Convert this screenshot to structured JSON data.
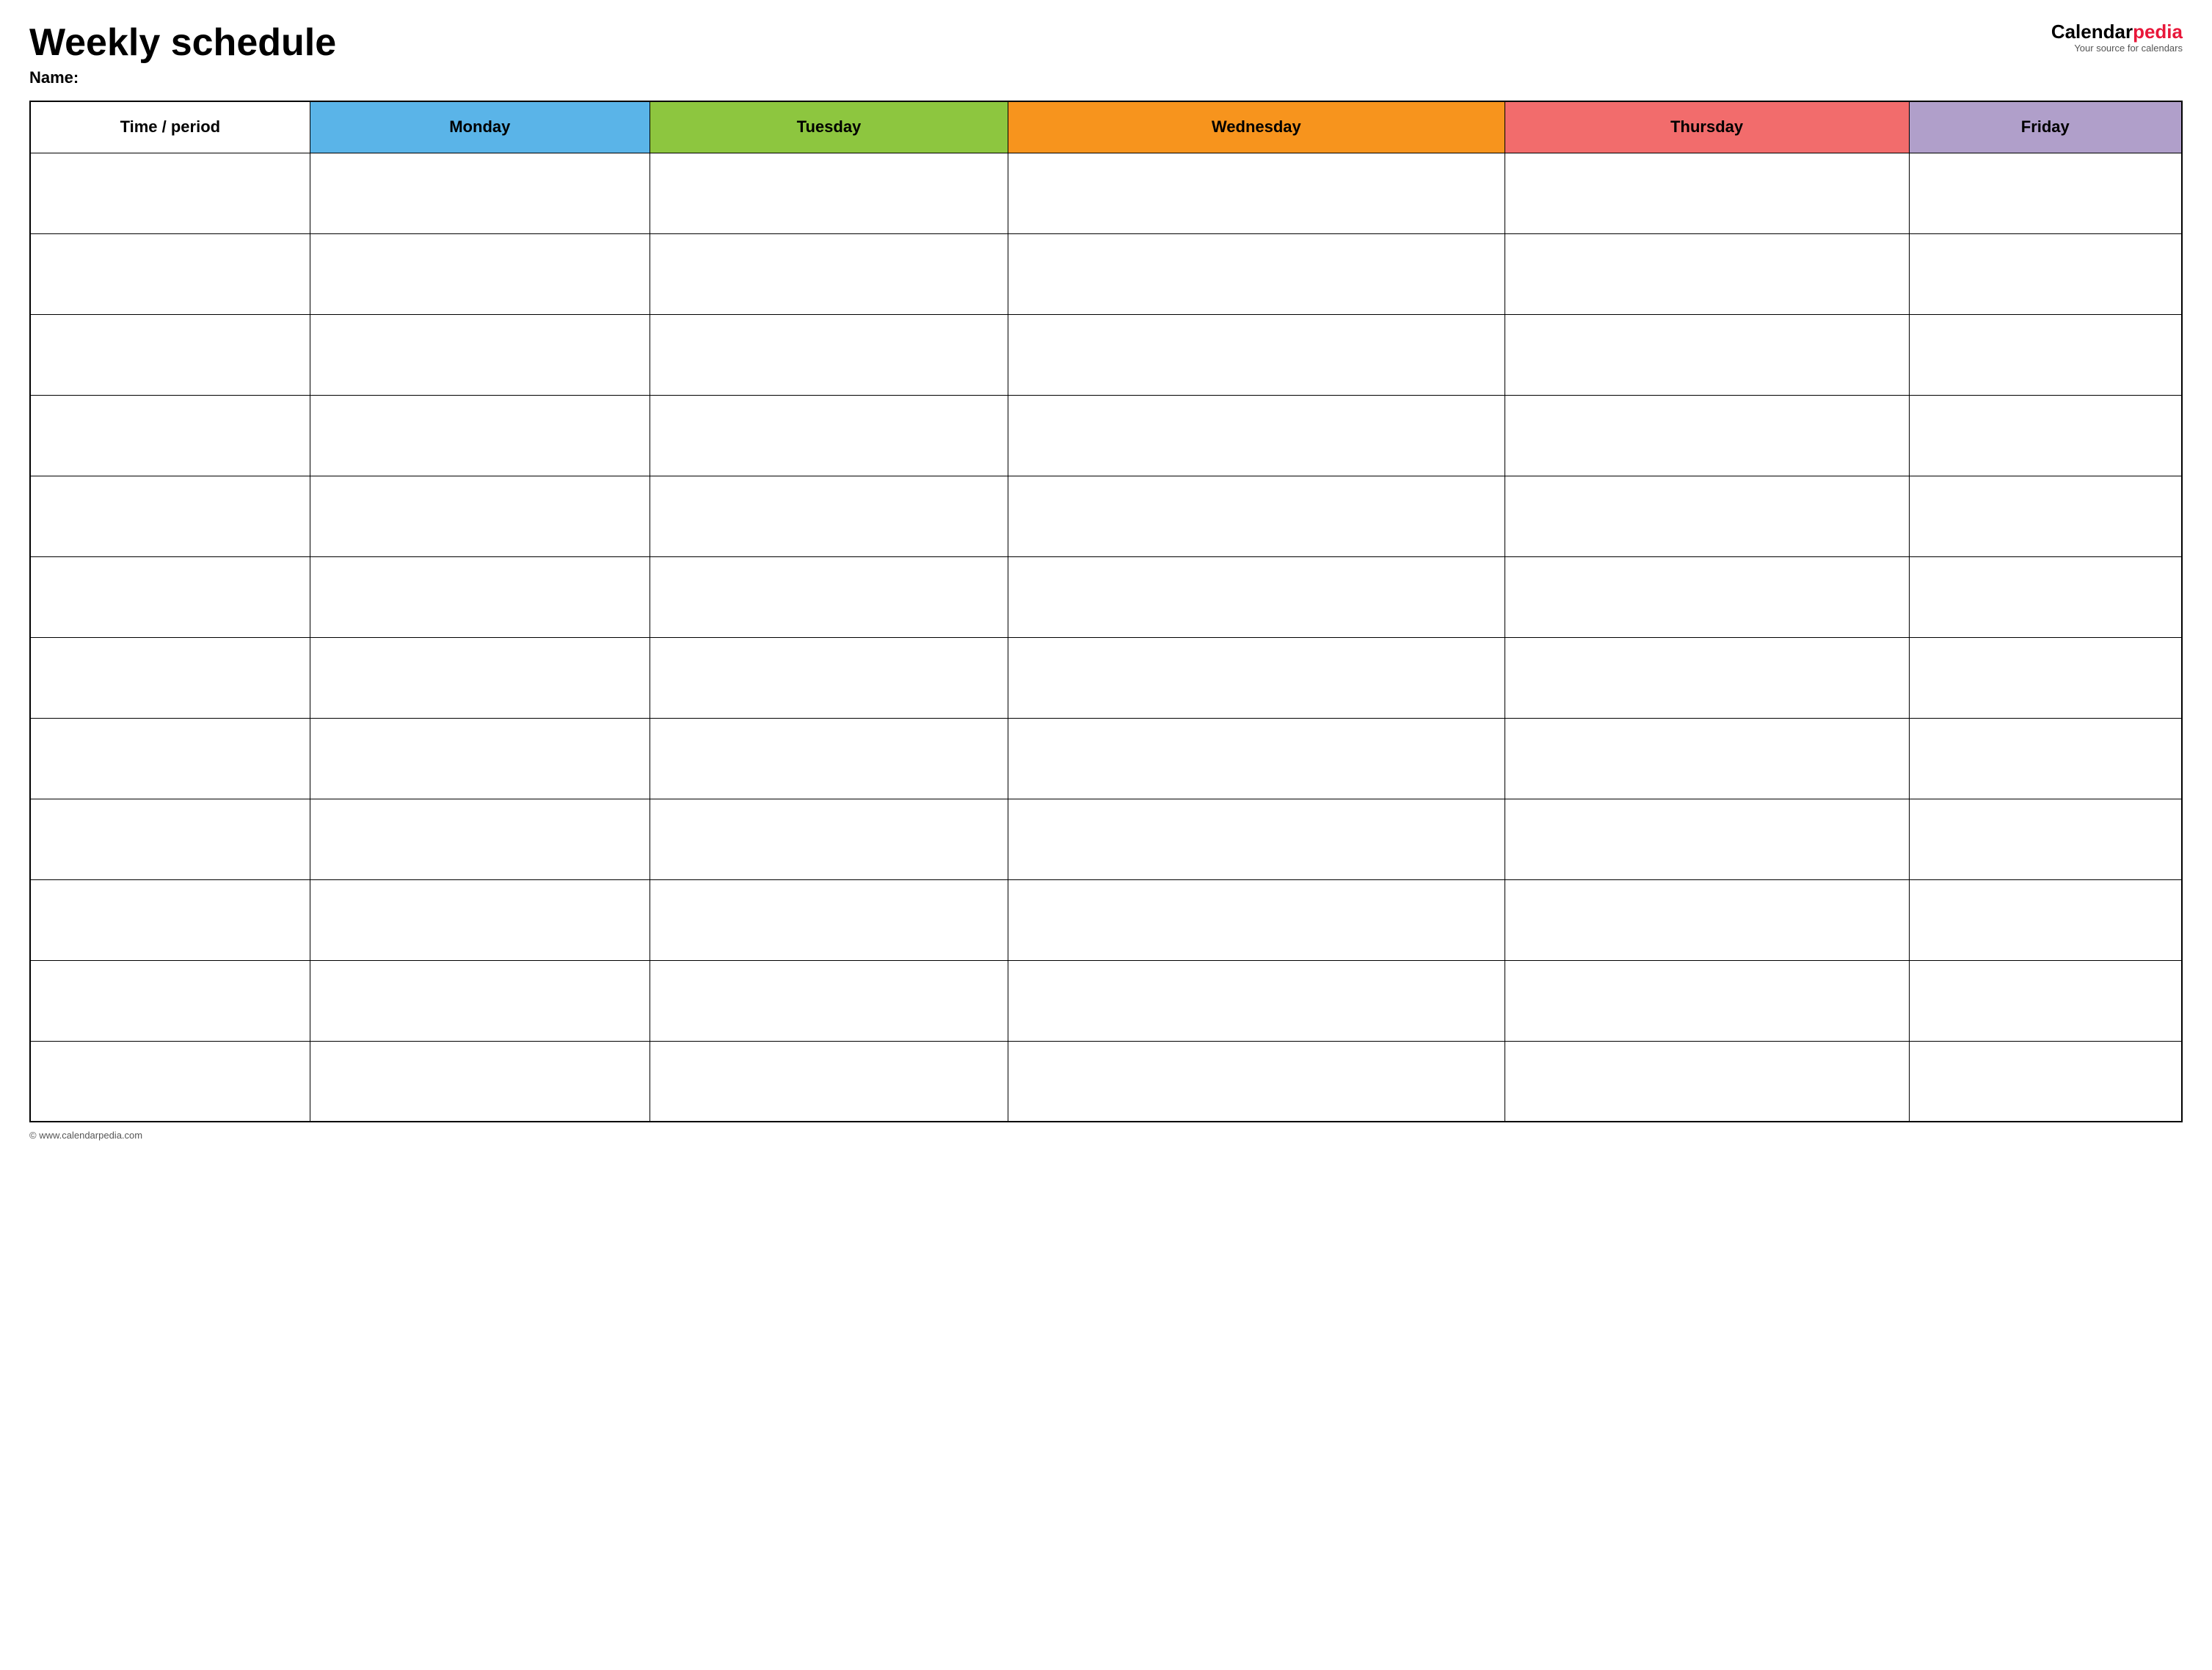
{
  "header": {
    "title": "Weekly schedule",
    "name_label": "Name:",
    "logo_calendar": "Calendar",
    "logo_pedia": "pedia",
    "logo_subtitle": "Your source for calendars"
  },
  "table": {
    "columns": [
      {
        "id": "time",
        "label": "Time / period",
        "color": "#fff"
      },
      {
        "id": "monday",
        "label": "Monday",
        "color": "#5ab4e8"
      },
      {
        "id": "tuesday",
        "label": "Tuesday",
        "color": "#8dc63f"
      },
      {
        "id": "wednesday",
        "label": "Wednesday",
        "color": "#f7941d"
      },
      {
        "id": "thursday",
        "label": "Thursday",
        "color": "#f26c6c"
      },
      {
        "id": "friday",
        "label": "Friday",
        "color": "#b09fca"
      }
    ],
    "row_count": 12
  },
  "footer": {
    "copyright": "© www.calendarpedia.com"
  }
}
